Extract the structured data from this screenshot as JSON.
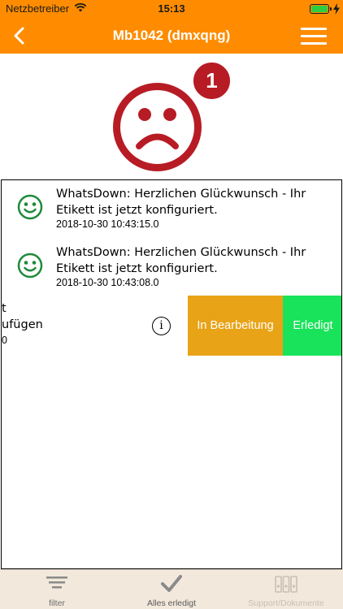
{
  "status_bar": {
    "carrier": "Netzbetreiber",
    "time": "15:13",
    "battery_level": 1.0
  },
  "nav": {
    "title": "Mb1042 (dmxqng)",
    "back_icon": "chevron-left-icon",
    "menu_icon": "hamburger-menu-icon",
    "background_color": "#FF8C00"
  },
  "status_face": {
    "icon": "sad-face-icon",
    "badge_count": "1",
    "color": "#B71C24"
  },
  "messages": [
    {
      "icon": "smiley-icon",
      "text": "WhatsDown: Herzlichen Glückwunsch - Ihr Etikett ist jetzt konfiguriert.",
      "date": "2018-10-30 10:43:15.0"
    },
    {
      "icon": "smiley-icon",
      "text": "WhatsDown: Herzlichen Glückwunsch - Ihr Etikett ist jetzt konfiguriert.",
      "date": "2018-10-30 10:43:08.0"
    }
  ],
  "swiped_row": {
    "fragments": [
      "t",
      "ufügen",
      "0"
    ],
    "info_icon": "info-icon",
    "action_in_progress": "In Bearbeitung",
    "action_done": "Erledigt",
    "in_progress_color": "#E8A317",
    "done_color": "#19E35A"
  },
  "tabbar": {
    "tabs": [
      {
        "label": "filter",
        "icon": "filter-lines-icon",
        "enabled": true
      },
      {
        "label": "Alles erledigt",
        "icon": "checkmark-icon",
        "enabled": true
      },
      {
        "label": "Support/Dokumente",
        "icon": "binders-icon",
        "enabled": false
      }
    ]
  }
}
